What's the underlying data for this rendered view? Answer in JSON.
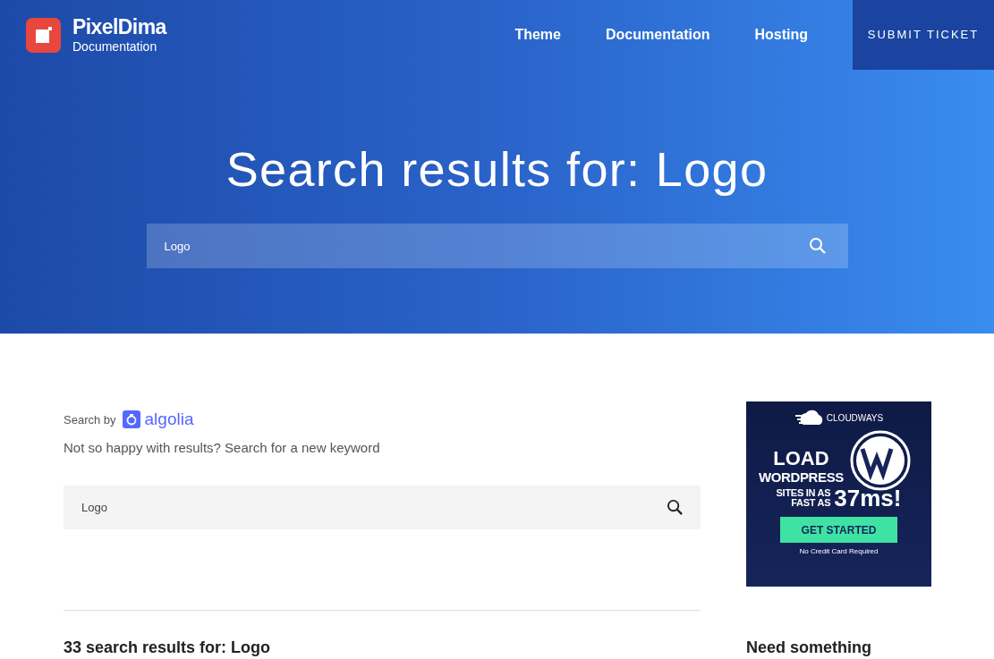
{
  "header": {
    "logo": {
      "name": "PixelDima",
      "subtitle": "Documentation"
    },
    "nav": [
      "Theme",
      "Documentation",
      "Hosting"
    ],
    "cta": "SUBMIT TICKET"
  },
  "hero": {
    "title": "Search results for: Logo",
    "search": {
      "value": "Logo"
    }
  },
  "main": {
    "search_by": "Search by",
    "provider": "algolia",
    "hint": "Not so happy with results? Search for a new keyword",
    "search": {
      "value": "Logo"
    },
    "results_heading": "33 search results for: Logo"
  },
  "sidebar": {
    "ad": {
      "brand": "CLOUDWAYS",
      "line_1": "LOAD",
      "line_2": "WORDPRESS",
      "line_3": "SITES IN AS",
      "line_4": "FAST AS",
      "highlight": "37ms!",
      "button": "GET STARTED",
      "note": "No Credit Card Required"
    },
    "widget_title": "Need something"
  }
}
